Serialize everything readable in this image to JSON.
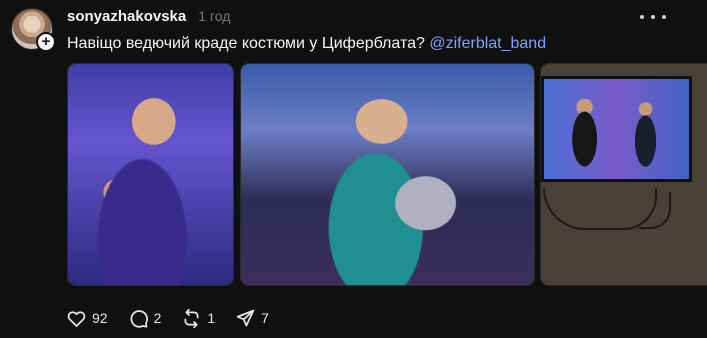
{
  "post": {
    "username": "sonyazhakovska",
    "time": "1 год",
    "text": "Навіщо ведючий краде костюми у Циферблата?",
    "mention": "@ziferblat_band"
  },
  "media": [
    {
      "name": "photo-host-purple-suit"
    },
    {
      "name": "photo-guitarist-teal-suit"
    },
    {
      "name": "photo-tv-screen"
    }
  ],
  "actions": {
    "like": {
      "icon": "heart-icon",
      "count": "92"
    },
    "reply": {
      "icon": "comment-icon",
      "count": "2"
    },
    "repost": {
      "icon": "repost-icon",
      "count": "1"
    },
    "share": {
      "icon": "send-icon",
      "count": "7"
    }
  },
  "colors": {
    "background": "#101010",
    "text": "#f3f5f7",
    "mention": "#78a3ff",
    "muted": "#777777"
  }
}
